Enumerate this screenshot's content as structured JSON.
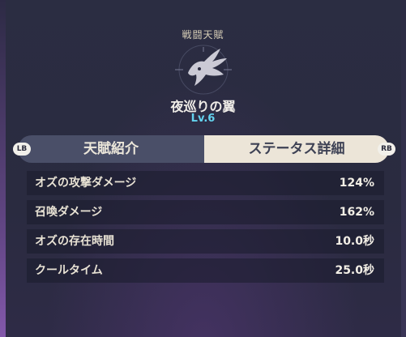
{
  "header": {
    "category": "戦闘天賦",
    "emblem_icon": "bird-wing-icon"
  },
  "talent": {
    "name": "夜巡りの翼",
    "level": "Lv.6"
  },
  "tabs": {
    "intro_label": "天賦紹介",
    "detail_label": "ステータス詳細",
    "active": "detail",
    "lb_hint": "LB",
    "rb_hint": "RB"
  },
  "stats": [
    {
      "label": "オズの攻撃ダメージ",
      "value": "124%"
    },
    {
      "label": "召喚ダメージ",
      "value": "162%"
    },
    {
      "label": "オズの存在時間",
      "value": "10.0秒"
    },
    {
      "label": "クールタイム",
      "value": "25.0秒"
    }
  ],
  "colors": {
    "background": "#2a2b40",
    "level_accent": "#64d3ef",
    "tab_active_bg": "#ece5d8",
    "tab_inactive_bg": "#4a4f68"
  }
}
